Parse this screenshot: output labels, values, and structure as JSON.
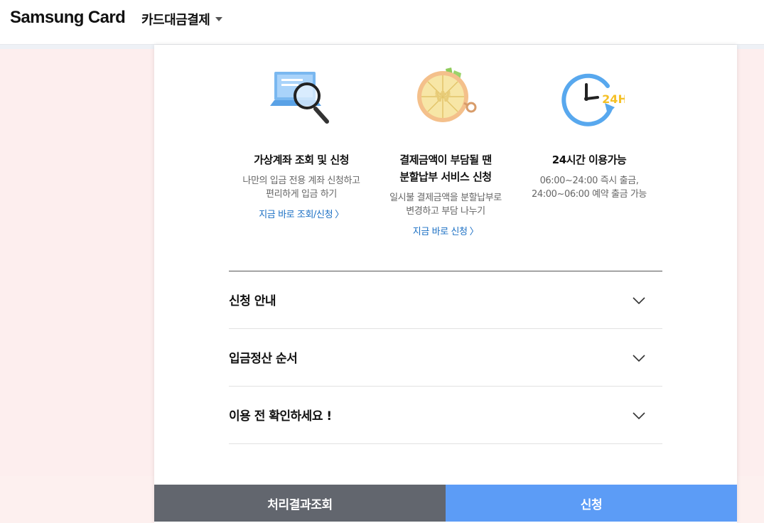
{
  "header": {
    "brand": "Samsung Card",
    "menu_label": "카드대금결제"
  },
  "features": [
    {
      "icon": "laptop-magnifier-icon",
      "title_lines": [
        "가상계좌 조회 및 신청"
      ],
      "desc_lines": [
        "나만의 입금 전용 계좌 신청하고",
        "편리하게 입금 하기"
      ],
      "link": "지금 바로 조회/신청"
    },
    {
      "icon": "lemon-slice-won-icon",
      "title_lines": [
        "결제금액이 부담될 땐",
        "분할납부 서비스 신청"
      ],
      "desc_lines": [
        "일시불 결제금액을 분할납부로",
        "변경하고 부담 나누기"
      ],
      "link": "지금 바로 신청"
    },
    {
      "icon": "clock-24h-icon",
      "icon_text": "24H",
      "title_lines": [
        "24시간 이용가능"
      ],
      "desc_lines": [
        "06:00~24:00 즉시 출금,",
        "24:00~06:00 예약 출금 가능"
      ]
    }
  ],
  "accordion": [
    {
      "title": "신청 안내"
    },
    {
      "title": "입금정산 순서"
    },
    {
      "title": "이용 전 확인하세요 !"
    }
  ],
  "buttons": {
    "result": "처리결과조회",
    "apply": "신청"
  },
  "colors": {
    "link": "#1a6fc4",
    "apply_button": "#5c9cf6",
    "result_button": "#62666e",
    "page_background": "#fdeeee"
  }
}
